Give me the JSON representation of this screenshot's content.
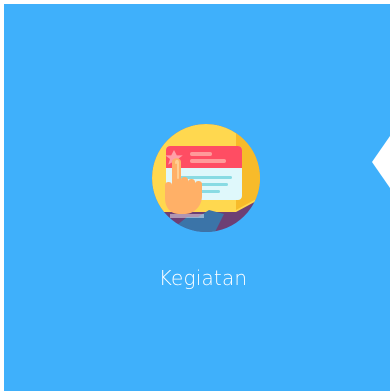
{
  "tile": {
    "label": "Kegiatan",
    "background_color": "#3fb0fb",
    "icon": "activity-screen-hand-icon"
  },
  "navigation": {
    "next_icon": "chevron-left-arrow-icon"
  }
}
